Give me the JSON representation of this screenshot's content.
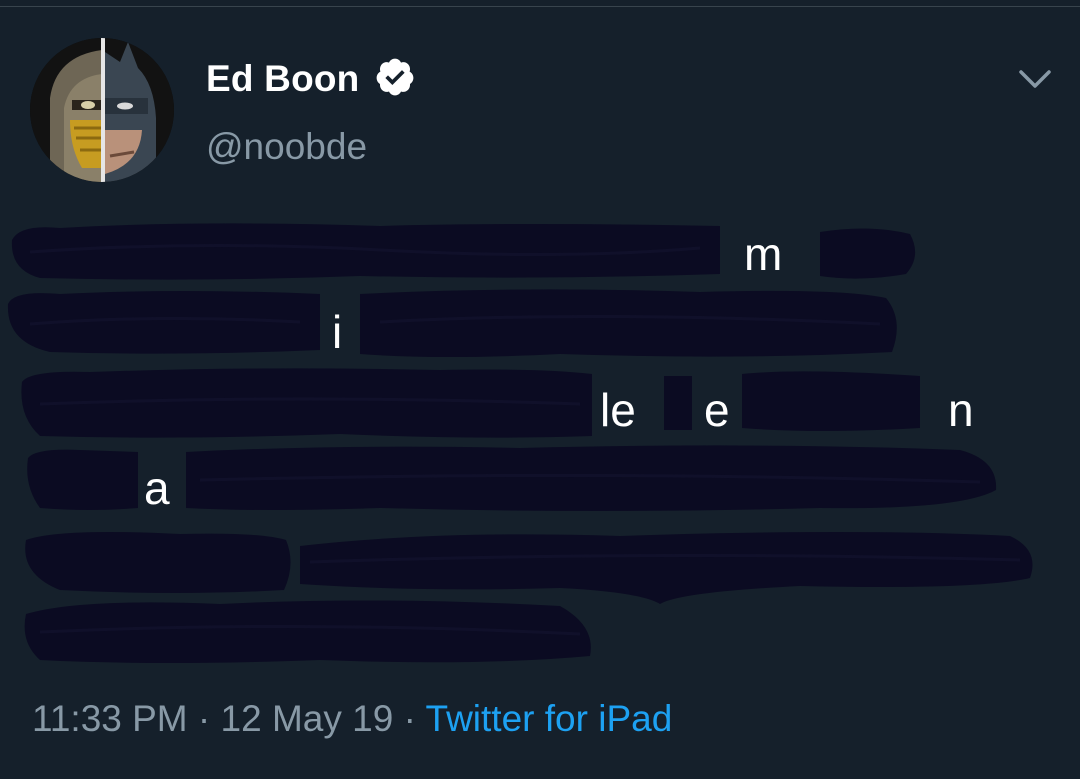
{
  "user": {
    "display_name": "Ed Boon",
    "handle": "@noobde",
    "verified": true
  },
  "tweet": {
    "visible_fragments": [
      {
        "text": "m"
      },
      {
        "text": "i"
      },
      {
        "text": "le"
      },
      {
        "text": "e"
      },
      {
        "text": "n"
      },
      {
        "text": "a"
      }
    ],
    "redacted": true
  },
  "meta": {
    "time": "11:33 PM",
    "separator": "·",
    "date": "12 May 19",
    "source": "Twitter for iPad"
  },
  "colors": {
    "background": "#15202b",
    "secondary_text": "#8899a6",
    "link": "#1da1f2",
    "redaction": "#0b0b22"
  },
  "icons": {
    "verified": "verified-badge-icon",
    "menu": "chevron-down-icon"
  }
}
